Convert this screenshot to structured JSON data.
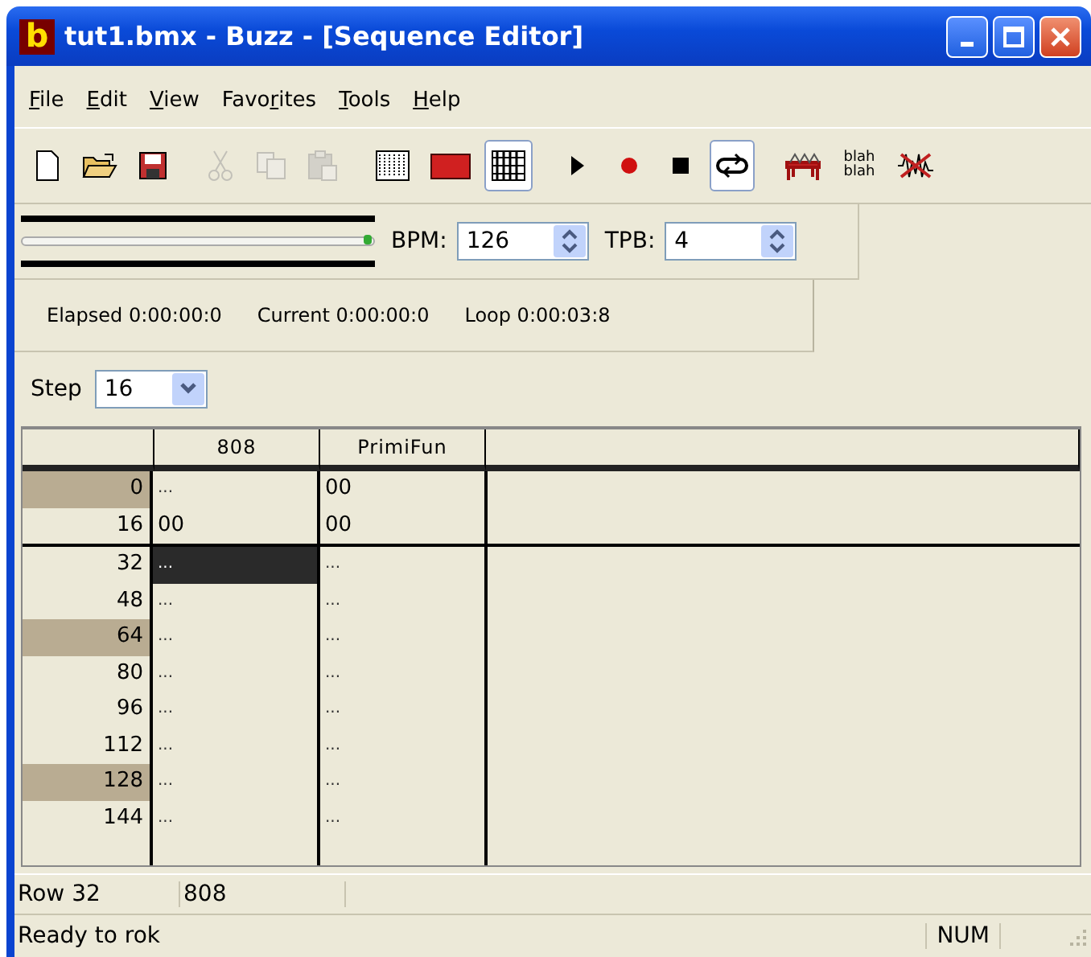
{
  "window": {
    "title": "tut1.bmx - Buzz - [Sequence Editor]",
    "app_icon": "b"
  },
  "menu": [
    {
      "accel": "F",
      "rest": "ile"
    },
    {
      "accel": "E",
      "rest": "dit"
    },
    {
      "accel": "V",
      "rest": "iew"
    },
    {
      "before": "Favo",
      "accel": "r",
      "rest": "ites"
    },
    {
      "accel": "T",
      "rest": "ools"
    },
    {
      "accel": "H",
      "rest": "elp"
    }
  ],
  "toolbar": [
    [
      {
        "kind": "new",
        "disabled": false,
        "pressed": false
      },
      {
        "kind": "open",
        "disabled": false,
        "pressed": false
      },
      {
        "kind": "save",
        "disabled": false,
        "pressed": false
      }
    ],
    [
      {
        "kind": "cut",
        "disabled": true,
        "pressed": false
      },
      {
        "kind": "copy",
        "disabled": true,
        "pressed": false
      },
      {
        "kind": "paste",
        "disabled": true,
        "pressed": false
      }
    ],
    [
      {
        "kind": "pattern",
        "disabled": false,
        "pressed": false
      },
      {
        "kind": "machines",
        "disabled": false,
        "pressed": false
      },
      {
        "kind": "sequence",
        "disabled": false,
        "pressed": true
      }
    ],
    [
      {
        "kind": "play",
        "disabled": false,
        "pressed": false
      },
      {
        "kind": "record",
        "disabled": false,
        "pressed": false
      },
      {
        "kind": "stop",
        "disabled": false,
        "pressed": false
      },
      {
        "kind": "loop",
        "disabled": false,
        "pressed": true
      }
    ],
    [
      {
        "kind": "table",
        "disabled": false,
        "pressed": false
      },
      {
        "kind": "text",
        "label": "blah blah",
        "disabled": false,
        "pressed": false
      },
      {
        "kind": "mute",
        "disabled": false,
        "pressed": false
      }
    ]
  ],
  "transport": {
    "position": {
      "level": 1
    },
    "bpm": {
      "label": "BPM:",
      "value": "126"
    },
    "tpb": {
      "label": "TPB:",
      "value": "4"
    }
  },
  "times": [
    "Elapsed 0:00:00:0",
    "Current 0:00:00:0",
    "Loop 0:00:03:8"
  ],
  "step": {
    "label": "Step",
    "value": "16"
  },
  "sequence": {
    "columns": [
      "808",
      "PrimiFun"
    ],
    "rows": [
      {
        "label": "0",
        "marked": true,
        "divider_above": false,
        "cells": [
          {
            "text": "...",
            "selected": false
          },
          {
            "text": "00",
            "selected": false
          }
        ]
      },
      {
        "label": "16",
        "marked": false,
        "divider_above": false,
        "cells": [
          {
            "text": "00",
            "selected": false
          },
          {
            "text": "00",
            "selected": false
          }
        ]
      },
      {
        "label": "32",
        "marked": false,
        "divider_above": true,
        "cells": [
          {
            "text": "...",
            "selected": true
          },
          {
            "text": "...",
            "selected": false
          }
        ]
      },
      {
        "label": "48",
        "marked": false,
        "divider_above": false,
        "cells": [
          {
            "text": "...",
            "selected": false
          },
          {
            "text": "...",
            "selected": false
          }
        ]
      },
      {
        "label": "64",
        "marked": true,
        "divider_above": false,
        "cells": [
          {
            "text": "...",
            "selected": false
          },
          {
            "text": "...",
            "selected": false
          }
        ]
      },
      {
        "label": "80",
        "marked": false,
        "divider_above": false,
        "cells": [
          {
            "text": "...",
            "selected": false
          },
          {
            "text": "...",
            "selected": false
          }
        ]
      },
      {
        "label": "96",
        "marked": false,
        "divider_above": false,
        "cells": [
          {
            "text": "...",
            "selected": false
          },
          {
            "text": "...",
            "selected": false
          }
        ]
      },
      {
        "label": "112",
        "marked": false,
        "divider_above": false,
        "cells": [
          {
            "text": "...",
            "selected": false
          },
          {
            "text": "...",
            "selected": false
          }
        ]
      },
      {
        "label": "128",
        "marked": true,
        "divider_above": false,
        "cells": [
          {
            "text": "...",
            "selected": false
          },
          {
            "text": "...",
            "selected": false
          }
        ]
      },
      {
        "label": "144",
        "marked": false,
        "divider_above": false,
        "cells": [
          {
            "text": "...",
            "selected": false
          },
          {
            "text": "...",
            "selected": false
          }
        ]
      }
    ]
  },
  "info_bar": [
    "Row 32",
    "808"
  ],
  "status_bar": {
    "message": "Ready to rok",
    "indicator": "NUM"
  }
}
